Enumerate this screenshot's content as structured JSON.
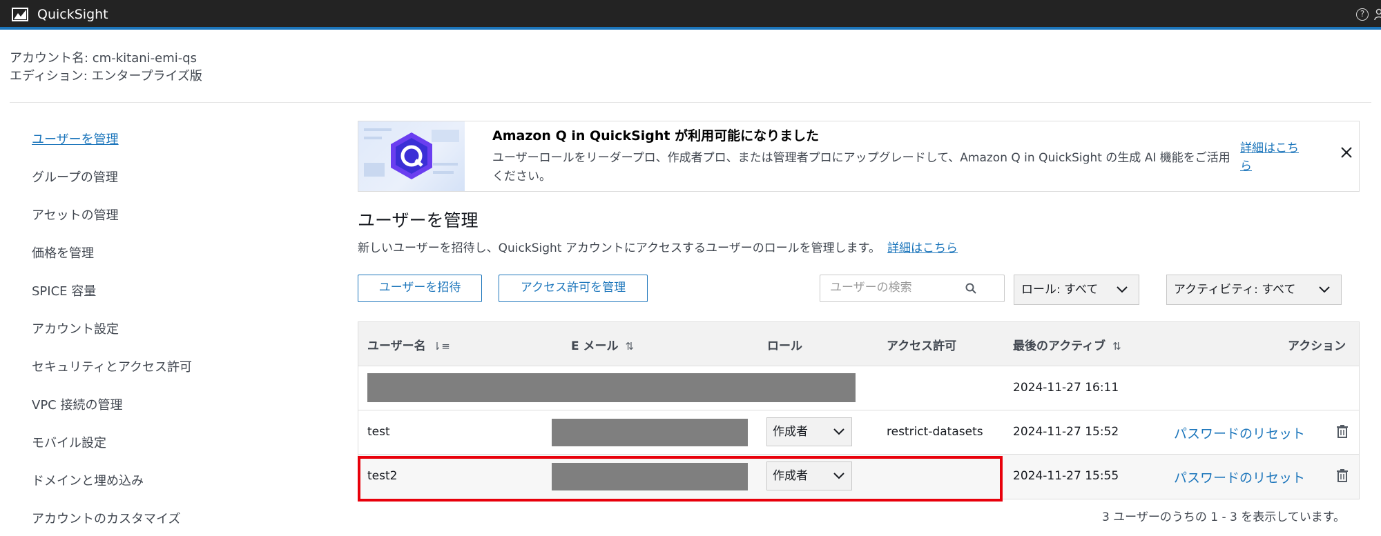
{
  "header": {
    "app_name": "QuickSight",
    "help_icon": "?"
  },
  "account": {
    "name_line": "アカウント名: cm-kitani-emi-qs",
    "edition_line": "エディション: エンタープライズ版"
  },
  "sidebar": {
    "items": [
      {
        "label": "ユーザーを管理",
        "active": true
      },
      {
        "label": "グループの管理"
      },
      {
        "label": "アセットの管理"
      },
      {
        "label": "価格を管理"
      },
      {
        "label": "SPICE 容量"
      },
      {
        "label": "アカウント設定"
      },
      {
        "label": "セキュリティとアクセス許可"
      },
      {
        "label": "VPC 接続の管理"
      },
      {
        "label": "モバイル設定"
      },
      {
        "label": "ドメインと埋め込み"
      },
      {
        "label": "アカウントのカスタマイズ"
      }
    ]
  },
  "banner": {
    "title": "Amazon Q in QuickSight が利用可能になりました",
    "text": "ユーザーロールをリーダープロ、作成者プロ、または管理者プロにアップグレードして、Amazon Q in QuickSight の生成 AI 機能をご活用ください。",
    "link": "詳細はこちら"
  },
  "page": {
    "title": "ユーザーを管理",
    "description": "新しいユーザーを招待し、QuickSight アカウントにアクセスするユーザーのロールを管理します。",
    "description_link": "詳細はこちら"
  },
  "toolbar": {
    "invite_label": "ユーザーを招待",
    "permissions_label": "アクセス許可を管理",
    "search_placeholder": "ユーザーの検索",
    "role_filter": "ロール: すべて",
    "activity_filter": "アクティビティ: すべて"
  },
  "table": {
    "headers": {
      "username": "ユーザー名",
      "email": "E メール",
      "role": "ロール",
      "permission": "アクセス許可",
      "last_active": "最後のアクティブ",
      "action": "アクション"
    },
    "rows": [
      {
        "username": "",
        "email": "",
        "role": "",
        "permission": "",
        "last_active": "2024-11-27 16:11",
        "action": ""
      },
      {
        "username": "test",
        "email": "",
        "role": "作成者",
        "permission": "restrict-datasets",
        "last_active": "2024-11-27 15:52",
        "action": "パスワードのリセット"
      },
      {
        "username": "test2",
        "email": "",
        "role": "作成者",
        "permission": "",
        "last_active": "2024-11-27 15:55",
        "action": "パスワードのリセット"
      }
    ],
    "footer": "3 ユーザーのうちの 1 - 3 を表示しています。"
  },
  "colors": {
    "accent": "#1b75bb",
    "topbar": "#232323",
    "highlight": "#e8000b",
    "redaction": "#7f7f7f"
  }
}
